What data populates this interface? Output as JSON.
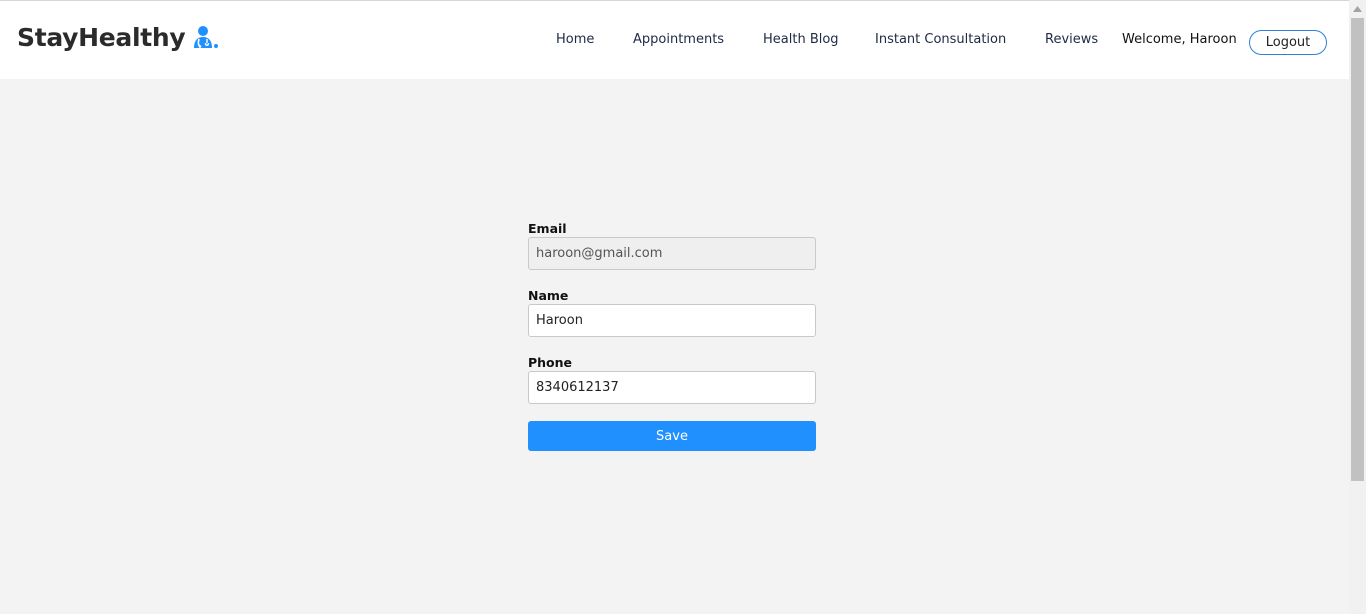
{
  "brand": {
    "name": "StayHealthy",
    "icon": "doctor-icon",
    "accent": "#2190ff"
  },
  "nav": {
    "links": [
      "Home",
      "Appointments",
      "Health Blog",
      "Instant Consultation",
      "Reviews"
    ],
    "welcome": "Welcome, Haroon",
    "logout_label": "Logout"
  },
  "form": {
    "email": {
      "label": "Email",
      "value": "haroon@gmail.com",
      "disabled": true
    },
    "name": {
      "label": "Name",
      "value": "Haroon"
    },
    "phone": {
      "label": "Phone",
      "value": "8340612137"
    },
    "save_label": "Save"
  },
  "colors": {
    "page_bg": "#f3f3f3",
    "navbar_bg": "#ffffff",
    "button": "#2190ff"
  }
}
